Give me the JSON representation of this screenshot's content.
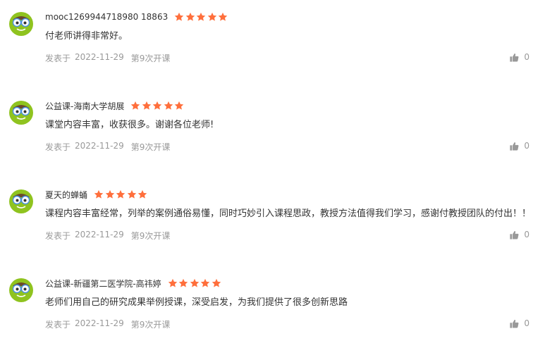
{
  "colors": {
    "star": "#ff6f3c",
    "text": "#333333",
    "meta": "#999999",
    "avatar_green": "#8fc31f"
  },
  "icons": {
    "avatar": "green-cartoon-avatar",
    "star": "star-icon",
    "like": "thumbs-up-icon"
  },
  "reviews": [
    {
      "username": "mooc1269944718980 18863",
      "rating": 5,
      "comment": "付老师讲得非常好。",
      "posted_label": "发表于",
      "date": "2022-11-29",
      "session": "第9次开课",
      "likes": "0"
    },
    {
      "username": "公益课-海南大学胡展",
      "rating": 5,
      "comment": "课堂内容丰富，收获很多。谢谢各位老师!",
      "posted_label": "发表于",
      "date": "2022-11-29",
      "session": "第9次开课",
      "likes": "0"
    },
    {
      "username": "夏天的蝉蛹",
      "rating": 5,
      "comment": "课程内容丰富经常，列举的案例通俗易懂，同时巧妙引入课程思政，教授方法值得我们学习，感谢付教授团队的付出！！",
      "posted_label": "发表于",
      "date": "2022-11-29",
      "session": "第9次开课",
      "likes": "0"
    },
    {
      "username": "公益课-新疆第二医学院-高祎婷",
      "rating": 5,
      "comment": "老师们用自己的研究成果举例授课，深受启发，为我们提供了很多创新思路",
      "posted_label": "发表于",
      "date": "2022-11-29",
      "session": "第9次开课",
      "likes": "0"
    }
  ]
}
